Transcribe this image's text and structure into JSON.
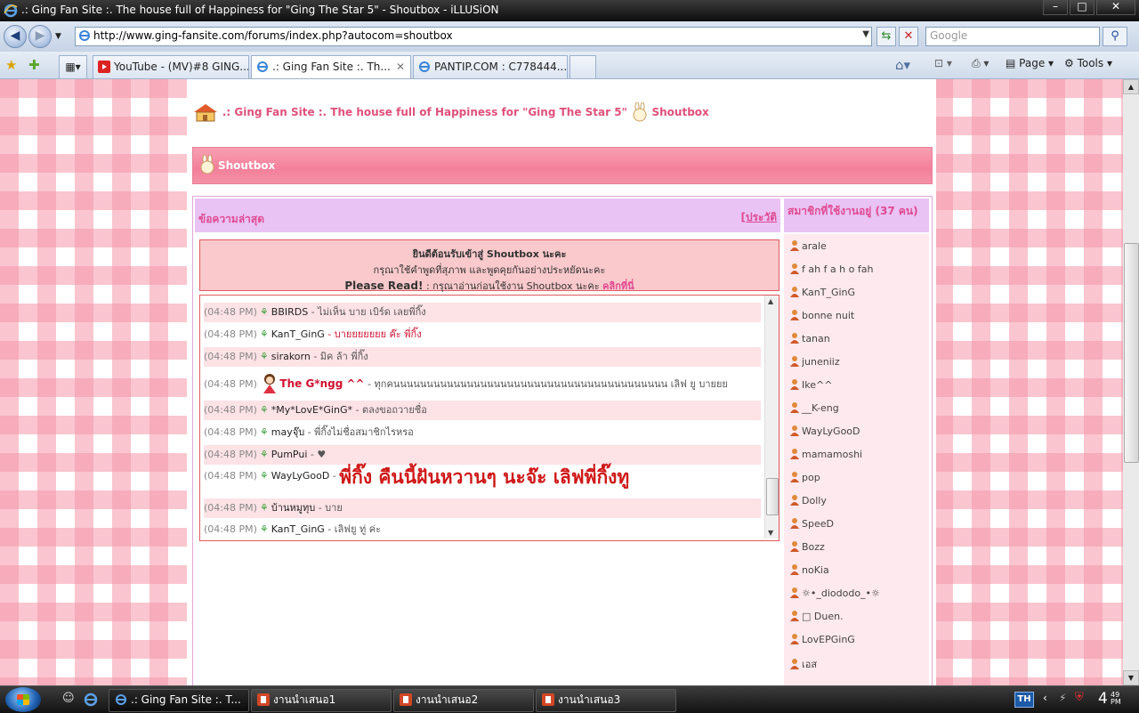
{
  "window": {
    "title": ".: Ging Fan Site :. The house full of Happiness for \"Ging The Star 5\" - Shoutbox - iLLUSiON",
    "min": "–",
    "max": "□",
    "close": "✕"
  },
  "browser": {
    "url": "http://www.ging-fansite.com/forums/index.php?autocom=shoutbox",
    "search_placeholder": "Google",
    "tabs": [
      {
        "label": "YouTube - (MV)#8 GING..."
      },
      {
        "label": ".: Ging Fan Site :. Th..."
      },
      {
        "label": "PANTIP.COM : C778444..."
      }
    ],
    "commands": {
      "page": "Page",
      "tools": "Tools"
    }
  },
  "page": {
    "headline_site": ".: Ging Fan Site :. The house full of Happiness for \"Ging The Star 5\"",
    "headline_section": "Shoutbox",
    "banner_title": "Shoutbox",
    "latest_label": "ข้อความล่าสุด",
    "history_label": "[ประวัติ",
    "members_label": "สมาชิกที่ใช้งานอยู่ (37 คน)",
    "welcome": {
      "line1": "ยินดีต้อนรับเข้าสู่ Shoutbox นะคะ",
      "line2": "กรุณาใช้คำพูดที่สุภาพ และพูดคุยกันอย่างประหยัดนะคะ",
      "line3_bold": "Please Read!",
      "line3_rest": " : กรุณาอ่านก่อนใช้งาน Shoutbox นะคะ ",
      "line3_link": "คลิกที่นี่"
    },
    "shouts": [
      {
        "time": "(04:48 PM)",
        "name": "BBIRDS",
        "msg": " - ไม่เห็น บาย เบิร์ด เลยพี่กิ๊ง"
      },
      {
        "time": "(04:48 PM)",
        "name": "KanT_GinG",
        "msg": " - บายยยยยยย ค๊ะ พี่กิ๊ง"
      },
      {
        "time": "(04:48 PM)",
        "name": "sirakorn",
        "msg": " - มิค ล้า พี่กิ๊ง"
      },
      {
        "time": "(04:48 PM)",
        "name": "The G*ngg ^^",
        "msg": " - ทุกคนนนนนนนนนนนนนนนนนนนนนนนนนนนนนนนนนนนนนนนนน เลิฟ ยู บายยย"
      },
      {
        "time": "(04:48 PM)",
        "name": "*My*LovE*GinG*",
        "msg": " - ตลงขอถวายชื่อ"
      },
      {
        "time": "(04:48 PM)",
        "name": "mayจุ๊บ",
        "msg": " - พี่กิ๊งไม่ชื่อสมาชิกไรหรอ"
      },
      {
        "time": "(04:48 PM)",
        "name": "PumPui",
        "msg": " - ♥"
      },
      {
        "time": "(04:48 PM)",
        "name": "WayLyGooD",
        "msg": " - ",
        "big": "พี่กิ๊ง คืนนี้ฝันหวานๆ นะจ๊ะ เลิฟพี่กิ๊งทู"
      },
      {
        "time": "(04:48 PM)",
        "name": "บ้านหมูทุบ",
        "msg": " - บาย"
      },
      {
        "time": "(04:48 PM)",
        "name": "KanT_GinG",
        "msg": " - เลิฟยู ทู่ ค่ะ"
      }
    ],
    "members": [
      "arale",
      "f ah f a h o fah",
      "KanT_GinG",
      "bonne nuit",
      "tanan",
      "juneniiz",
      "Ike^^",
      "__K-eng",
      "WayLyGooD",
      "mamamoshi",
      "pop",
      "Dolly",
      "SpeeD",
      "Bozz",
      "noKia",
      "☼•_diododo_•☼",
      "□ Duen.",
      "LovEPGinG",
      "เอส"
    ]
  },
  "taskbar": {
    "items": [
      {
        "label": ".: Ging Fan Site :. T..."
      },
      {
        "label": "งานนำเสนอ1"
      },
      {
        "label": "งานนำเสนอ2"
      },
      {
        "label": "งานนำเสนอ3"
      }
    ],
    "lang": "TH",
    "clock_hour": "4",
    "clock_min": "49",
    "clock_ampm": "PM"
  },
  "colors": {
    "accent_pink": "#e04a92",
    "shout_red": "#d01818",
    "leaf_green": "#39a13a"
  }
}
